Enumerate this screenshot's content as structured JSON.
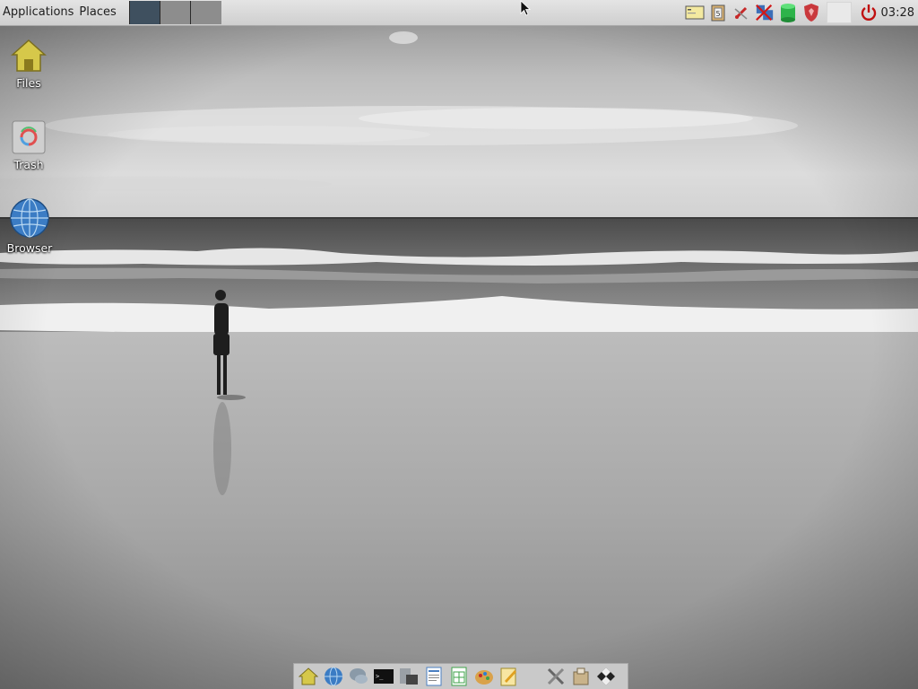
{
  "top_panel": {
    "menus": [
      "Applications",
      "Places"
    ],
    "workspaces": [
      {
        "name": "workspace-1",
        "active": true
      },
      {
        "name": "workspace-2",
        "active": false
      },
      {
        "name": "workspace-3",
        "active": false
      }
    ],
    "tray_icons": [
      "notes-icon",
      "clipboard-icon",
      "network-disconnected-icon",
      "network-offline-icon",
      "database-icon",
      "shield-icon"
    ],
    "clock": "03:28"
  },
  "desktop": {
    "icons": [
      {
        "label": "Files",
        "icon": "home-folder-icon"
      },
      {
        "label": "Trash",
        "icon": "trash-icon"
      },
      {
        "label": "Browser",
        "icon": "globe-icon"
      }
    ]
  },
  "dock": {
    "items": [
      "home-icon",
      "globe-icon",
      "chat-icon",
      "terminal-icon",
      "monitor-icon",
      "document-icon",
      "spreadsheet-icon",
      "paint-icon",
      "text-editor-icon",
      "tools-icon",
      "package-icon",
      "checkers-icon"
    ]
  },
  "colors": {
    "panel_bg": "#d8d8d8",
    "active_workspace": "#3f505f",
    "inactive_workspace": "#8d8d8d",
    "power": "#c01010"
  }
}
